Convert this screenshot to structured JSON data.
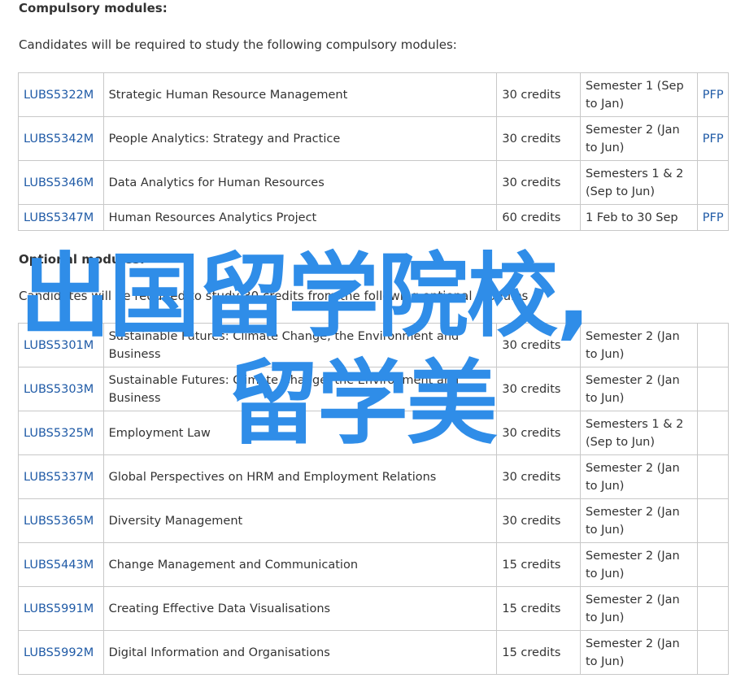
{
  "compulsory": {
    "heading": "Compulsory modules:",
    "intro": "Candidates will be required to study the following compulsory modules:",
    "rows": [
      {
        "code": "LUBS5322M",
        "title": "Strategic Human Resource Management",
        "credits": "30 credits",
        "semester": "Semester 1 (Sep to Jan)",
        "pfp": "PFP"
      },
      {
        "code": "LUBS5342M",
        "title": "People Analytics: Strategy and Practice",
        "credits": "30 credits",
        "semester": "Semester 2 (Jan to Jun)",
        "pfp": "PFP"
      },
      {
        "code": "LUBS5346M",
        "title": "Data Analytics for Human Resources",
        "credits": "30 credits",
        "semester": "Semesters 1 & 2 (Sep to Jun)",
        "pfp": ""
      },
      {
        "code": "LUBS5347M",
        "title": "Human Resources Analytics Project",
        "credits": "60 credits",
        "semester": "1 Feb to 30 Sep",
        "pfp": "PFP"
      }
    ]
  },
  "optional": {
    "heading": "Optional modules:",
    "intro": "Candidates will be required to study 30 credits from the following optional modules",
    "rows": [
      {
        "code": "LUBS5301M",
        "title": "Sustainable Futures: Climate Change, the Environment and Business",
        "credits": "30 credits",
        "semester": "Semester 2 (Jan to Jun)",
        "pfp": ""
      },
      {
        "code": "LUBS5303M",
        "title": "Sustainable Futures: Climate Change, the Environment and Business",
        "credits": "30 credits",
        "semester": "Semester 2 (Jan to Jun)",
        "pfp": ""
      },
      {
        "code": "LUBS5325M",
        "title": "Employment Law",
        "credits": "30 credits",
        "semester": "Semesters 1 & 2 (Sep to Jun)",
        "pfp": ""
      },
      {
        "code": "LUBS5337M",
        "title": "Global Perspectives on HRM and Employment Relations",
        "credits": "30 credits",
        "semester": "Semester 2 (Jan to Jun)",
        "pfp": ""
      },
      {
        "code": "LUBS5365M",
        "title": "Diversity Management",
        "credits": "30 credits",
        "semester": "Semester 2 (Jan to Jun)",
        "pfp": ""
      },
      {
        "code": "LUBS5443M",
        "title": "Change Management and Communication",
        "credits": "15 credits",
        "semester": "Semester 2 (Jan to Jun)",
        "pfp": ""
      },
      {
        "code": "LUBS5991M",
        "title": "Creating Effective Data Visualisations",
        "credits": "15 credits",
        "semester": "Semester 2 (Jan to Jun)",
        "pfp": ""
      },
      {
        "code": "LUBS5992M",
        "title": "Digital Information and Organisations",
        "credits": "15 credits",
        "semester": "Semester 2 (Jan to Jun)",
        "pfp": ""
      }
    ]
  },
  "overlay": {
    "line1": "出国留学院校,",
    "line2": "留学美"
  },
  "colors": {
    "link": "#1f5aa6",
    "overlay": "#2f8de8",
    "border": "#c8c8c8",
    "text": "#333333"
  }
}
